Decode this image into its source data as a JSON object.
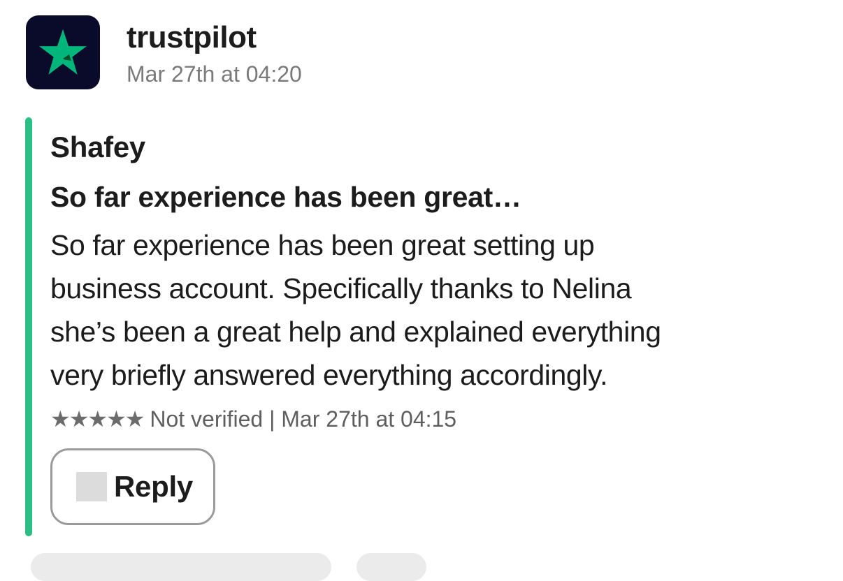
{
  "message": {
    "app_name": "trustpilot",
    "posted_at": "Mar 27th at 04:20",
    "avatar_icon": "trustpilot-star-icon",
    "brand_color": "#00B67A",
    "accent_color": "#2BBF86"
  },
  "review": {
    "reviewer": "Shafey",
    "title": "So far experience has been great…",
    "body_lines": [
      "So far experience has been great setting up",
      "business account. Specifically thanks to Nelina",
      "she’s been a great help and explained everything",
      "very briefly answered everything accordingly."
    ],
    "stars_text": "★★★★★",
    "rating": 5,
    "meta": "Not verified | Mar 27th at 04:15"
  },
  "actions": {
    "reply_label": "Reply",
    "reply_icon": "reply-icon"
  }
}
